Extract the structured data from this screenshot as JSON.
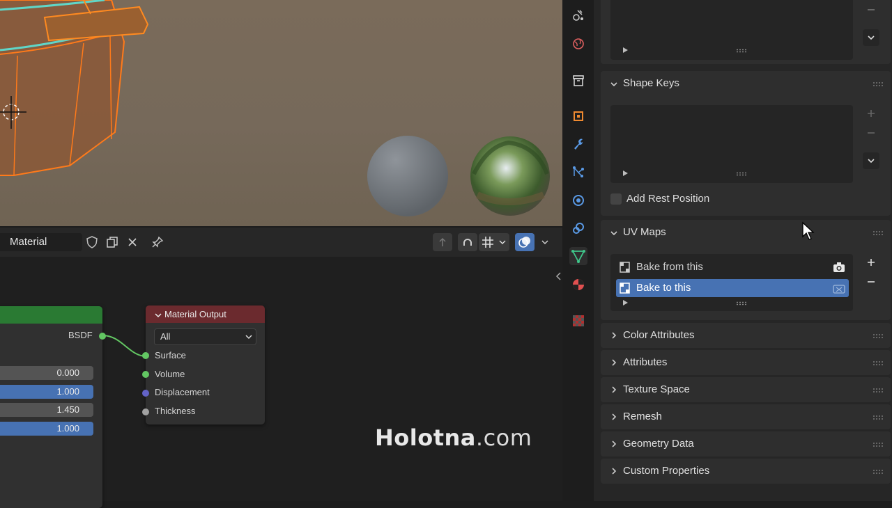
{
  "node_editor": {
    "header": {
      "material_field": "Material"
    },
    "principled_node": {
      "output_label": "BSDF",
      "values": [
        "0.000",
        "1.000",
        "1.450",
        "1.000"
      ]
    },
    "material_output": {
      "title": "Material Output",
      "target_select": "All",
      "sockets": [
        "Surface",
        "Volume",
        "Displacement",
        "Thickness"
      ]
    }
  },
  "properties": {
    "shape_keys": {
      "title": "Shape Keys"
    },
    "add_rest_position": "Add Rest Position",
    "uv_maps": {
      "title": "UV Maps",
      "items": [
        {
          "label": "Bake from this",
          "selected": false
        },
        {
          "label": "Bake to this",
          "selected": true
        }
      ]
    },
    "collapsed_panels": [
      "Color Attributes",
      "Attributes",
      "Texture Space",
      "Remesh",
      "Geometry Data",
      "Custom Properties"
    ]
  },
  "watermark": {
    "bold": "Holotna",
    "rest": ".com"
  },
  "colors": {
    "accent": "#4772b3",
    "node_header_output": "#6b2a2e",
    "node_header_shader": "#2a7a33",
    "socket_shader": "#63c763",
    "socket_vector": "#6363c7",
    "socket_float": "#a1a1a1"
  }
}
